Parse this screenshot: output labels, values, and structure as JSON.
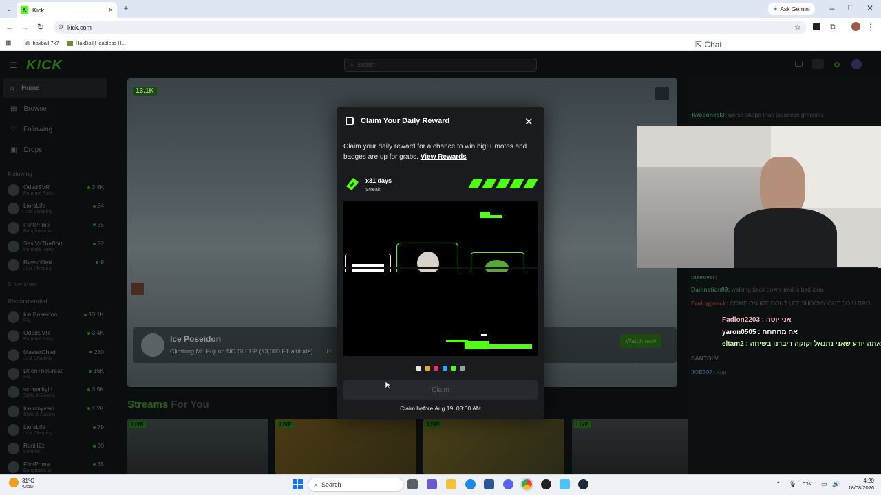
{
  "browser": {
    "tab_title": "Kick",
    "url": "kick.com",
    "gemini_label": "Ask Gemini",
    "bookmarks": [
      "haxball 7x7",
      "HaxBall Headless H..."
    ]
  },
  "site": {
    "logo": "KICK",
    "search_placeholder": "Search",
    "nav": [
      "Home",
      "Browse",
      "Following",
      "Drops"
    ],
    "following_header": "Following",
    "show_more": "Show More",
    "recommended_header": "Recommended",
    "following": [
      {
        "name": "OdedSVR",
        "category": "Pummel Party",
        "viewers": "3.4K"
      },
      {
        "name": "LiorsLife",
        "category": "Just Sleeping",
        "viewers": "84"
      },
      {
        "name": "FlintPrime",
        "category": "Bangbattle.io",
        "viewers": "35"
      },
      {
        "name": "SasiVeTheBoiz",
        "category": "Pummel Party",
        "viewers": "22"
      },
      {
        "name": "Rawchilled",
        "category": "Just Sleeping",
        "viewers": "9"
      }
    ],
    "recommended": [
      {
        "name": "Ice Poseidon",
        "category": "IRL",
        "viewers": "13.1K"
      },
      {
        "name": "OdedSVR",
        "category": "Pummel Party",
        "viewers": "3.4K"
      },
      {
        "name": "MasterOhad",
        "category": "Just Chatting",
        "viewers": "280"
      },
      {
        "name": "DeenTheGreat",
        "category": "IRL",
        "viewers": "16K"
      },
      {
        "name": "schneckyirl",
        "category": "Slots & Casino",
        "viewers": "3.5K"
      },
      {
        "name": "Iceinmyvein",
        "category": "Slots & Casino",
        "viewers": "1.2K"
      },
      {
        "name": "LiorsLife",
        "category": "Just Sleeping",
        "viewers": "79"
      },
      {
        "name": "RonilIZz",
        "category": "Fortnite",
        "viewers": "30"
      },
      {
        "name": "FlintPrime",
        "category": "Bangbattle.io",
        "viewers": "35"
      }
    ]
  },
  "player": {
    "viewer_badge": "13.1K",
    "streamer": "Ice Poseidon",
    "stream_title": "Climbing Mt. Fuji on NO SLEEP (13,000 FT altitude)",
    "category": "IRL",
    "watch_now": "Watch now"
  },
  "streams_for_you": {
    "accent": "Streams",
    "rest": " For You",
    "live_label": "LIVE"
  },
  "chat": {
    "header": "Chat",
    "messages": [
      {
        "user": "Twobonesl3:",
        "text": "worse shape than japanese grannies",
        "color": "#2f6b4a"
      },
      {
        "user": "takeover:",
        "text": "",
        "color": "#2f6b4a"
      },
      {
        "user": "Damnation89:",
        "text": "walking back down tired is bad idea",
        "color": "#2f6b4a"
      },
      {
        "user": "Eruloggkeck:",
        "text": "COME ON ICE DONT LET SHOOVY OUT DO U BRO",
        "color": "#6b2f2f"
      },
      {
        "user": "SANTOLV:",
        "text": "",
        "color": "#4e4e4e"
      },
      {
        "user": "JOE707:",
        "text": "Kpp",
        "color": "#2f4e6b"
      }
    ],
    "overlay": [
      {
        "text": "Fadlon2203 : אני יוסה",
        "color": "#ffb3c7"
      },
      {
        "text": "yaron0505 : אה מחחחח",
        "color": "#ffffff"
      },
      {
        "text": "eltam2 : בוב אתה יודע שאני נתנאל וקוקה דיברנו בשיחה",
        "color": "#c8ff9a"
      }
    ]
  },
  "modal": {
    "title": "Claim Your Daily Reward",
    "description": "Claim your daily reward for a chance to win big! Emotes and badges are up for grabs.",
    "view_rewards": "View Rewards",
    "streak_days": "x31 days",
    "streak_label": "Streak",
    "claim": "Claim",
    "claim_before": "Claim before Aug 19, 03:00 AM",
    "palette": [
      "#e5e5e5",
      "#f5a623",
      "#e8336a",
      "#3aa0ff",
      "#53fc18",
      "#9aa0a6"
    ]
  },
  "taskbar": {
    "weather_temp": "31°C",
    "weather_desc": "שמשי",
    "search": "Search",
    "lang": "עבר",
    "time": "4:20",
    "date": "18/08/2026"
  },
  "colors": {
    "kick_green": "#53fc18",
    "modal_bg": "#191b1f"
  }
}
